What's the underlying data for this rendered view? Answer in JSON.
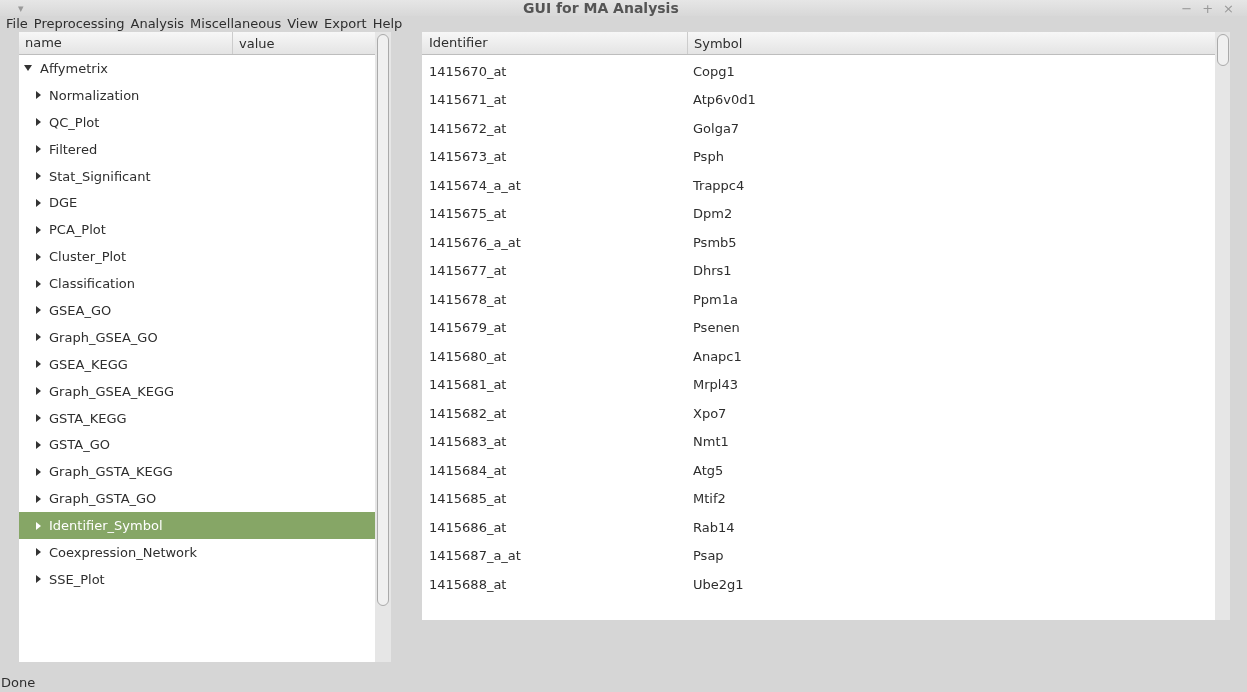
{
  "window": {
    "title": "GUI for MA Analysis",
    "menu_glyph": "▾",
    "controls": [
      "−",
      "+",
      "×"
    ]
  },
  "menu": [
    "File",
    "Preprocessing",
    "Analysis",
    "Miscellaneous",
    "View",
    "Export",
    "Help"
  ],
  "tree": {
    "columns": [
      "name",
      "value"
    ],
    "items": [
      {
        "label": "Affymetrix",
        "expanded": true,
        "selected": false,
        "children": [
          {
            "label": "Normalization",
            "expanded": false,
            "selected": false
          },
          {
            "label": "QC_Plot",
            "expanded": false,
            "selected": false
          },
          {
            "label": "Filtered",
            "expanded": false,
            "selected": false
          },
          {
            "label": "Stat_Significant",
            "expanded": false,
            "selected": false
          },
          {
            "label": "DGE",
            "expanded": false,
            "selected": false
          },
          {
            "label": "PCA_Plot",
            "expanded": false,
            "selected": false
          },
          {
            "label": "Cluster_Plot",
            "expanded": false,
            "selected": false
          },
          {
            "label": "Classification",
            "expanded": false,
            "selected": false
          },
          {
            "label": "GSEA_GO",
            "expanded": false,
            "selected": false
          },
          {
            "label": "Graph_GSEA_GO",
            "expanded": false,
            "selected": false
          },
          {
            "label": "GSEA_KEGG",
            "expanded": false,
            "selected": false
          },
          {
            "label": "Graph_GSEA_KEGG",
            "expanded": false,
            "selected": false
          },
          {
            "label": "GSTA_KEGG",
            "expanded": false,
            "selected": false
          },
          {
            "label": "GSTA_GO",
            "expanded": false,
            "selected": false
          },
          {
            "label": "Graph_GSTA_KEGG",
            "expanded": false,
            "selected": false
          },
          {
            "label": "Graph_GSTA_GO",
            "expanded": false,
            "selected": false
          },
          {
            "label": "Identifier_Symbol",
            "expanded": false,
            "selected": true
          },
          {
            "label": "Coexpression_Network",
            "expanded": false,
            "selected": false
          },
          {
            "label": "SSE_Plot",
            "expanded": false,
            "selected": false
          }
        ]
      }
    ]
  },
  "table": {
    "columns": [
      "Identifier",
      "Symbol"
    ],
    "rows": [
      [
        "1415670_at",
        "Copg1"
      ],
      [
        "1415671_at",
        "Atp6v0d1"
      ],
      [
        "1415672_at",
        "Golga7"
      ],
      [
        "1415673_at",
        "Psph"
      ],
      [
        "1415674_a_at",
        "Trappc4"
      ],
      [
        "1415675_at",
        "Dpm2"
      ],
      [
        "1415676_a_at",
        "Psmb5"
      ],
      [
        "1415677_at",
        "Dhrs1"
      ],
      [
        "1415678_at",
        "Ppm1a"
      ],
      [
        "1415679_at",
        "Psenen"
      ],
      [
        "1415680_at",
        "Anapc1"
      ],
      [
        "1415681_at",
        "Mrpl43"
      ],
      [
        "1415682_at",
        "Xpo7"
      ],
      [
        "1415683_at",
        "Nmt1"
      ],
      [
        "1415684_at",
        "Atg5"
      ],
      [
        "1415685_at",
        "Mtif2"
      ],
      [
        "1415686_at",
        "Rab14"
      ],
      [
        "1415687_a_at",
        "Psap"
      ],
      [
        "1415688_at",
        "Ube2g1"
      ]
    ]
  },
  "status_bar": "Done"
}
